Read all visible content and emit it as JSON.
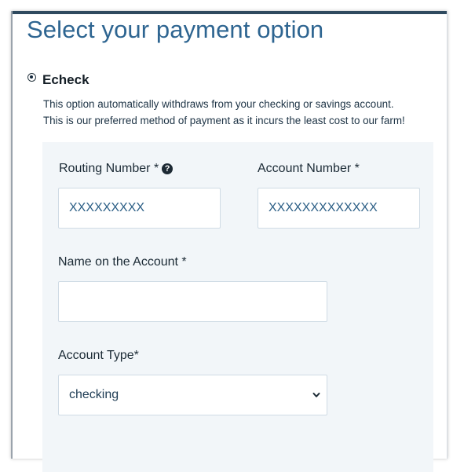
{
  "title": "Select your payment option",
  "payment_option": {
    "label": "Echeck",
    "selected": true,
    "description_line1": "This option automatically withdraws from your checking or savings account.",
    "description_line2": "This is our preferred method of payment as it incurs the least cost to our farm!"
  },
  "form": {
    "routing": {
      "label": "Routing Number *",
      "value": "XXXXXXXXX",
      "help_icon": "question-circle-icon"
    },
    "account": {
      "label": "Account Number *",
      "value": "XXXXXXXXXXXXX"
    },
    "name": {
      "label": "Name on the Account *",
      "value": ""
    },
    "account_type": {
      "label": "Account Type*",
      "value": "checking",
      "icon": "chevron-down-icon"
    }
  },
  "colors": {
    "title": "#2e6591",
    "field_text": "#2c5f86",
    "form_background": "#f2f6f9",
    "top_bar": "#2f4a5f"
  }
}
